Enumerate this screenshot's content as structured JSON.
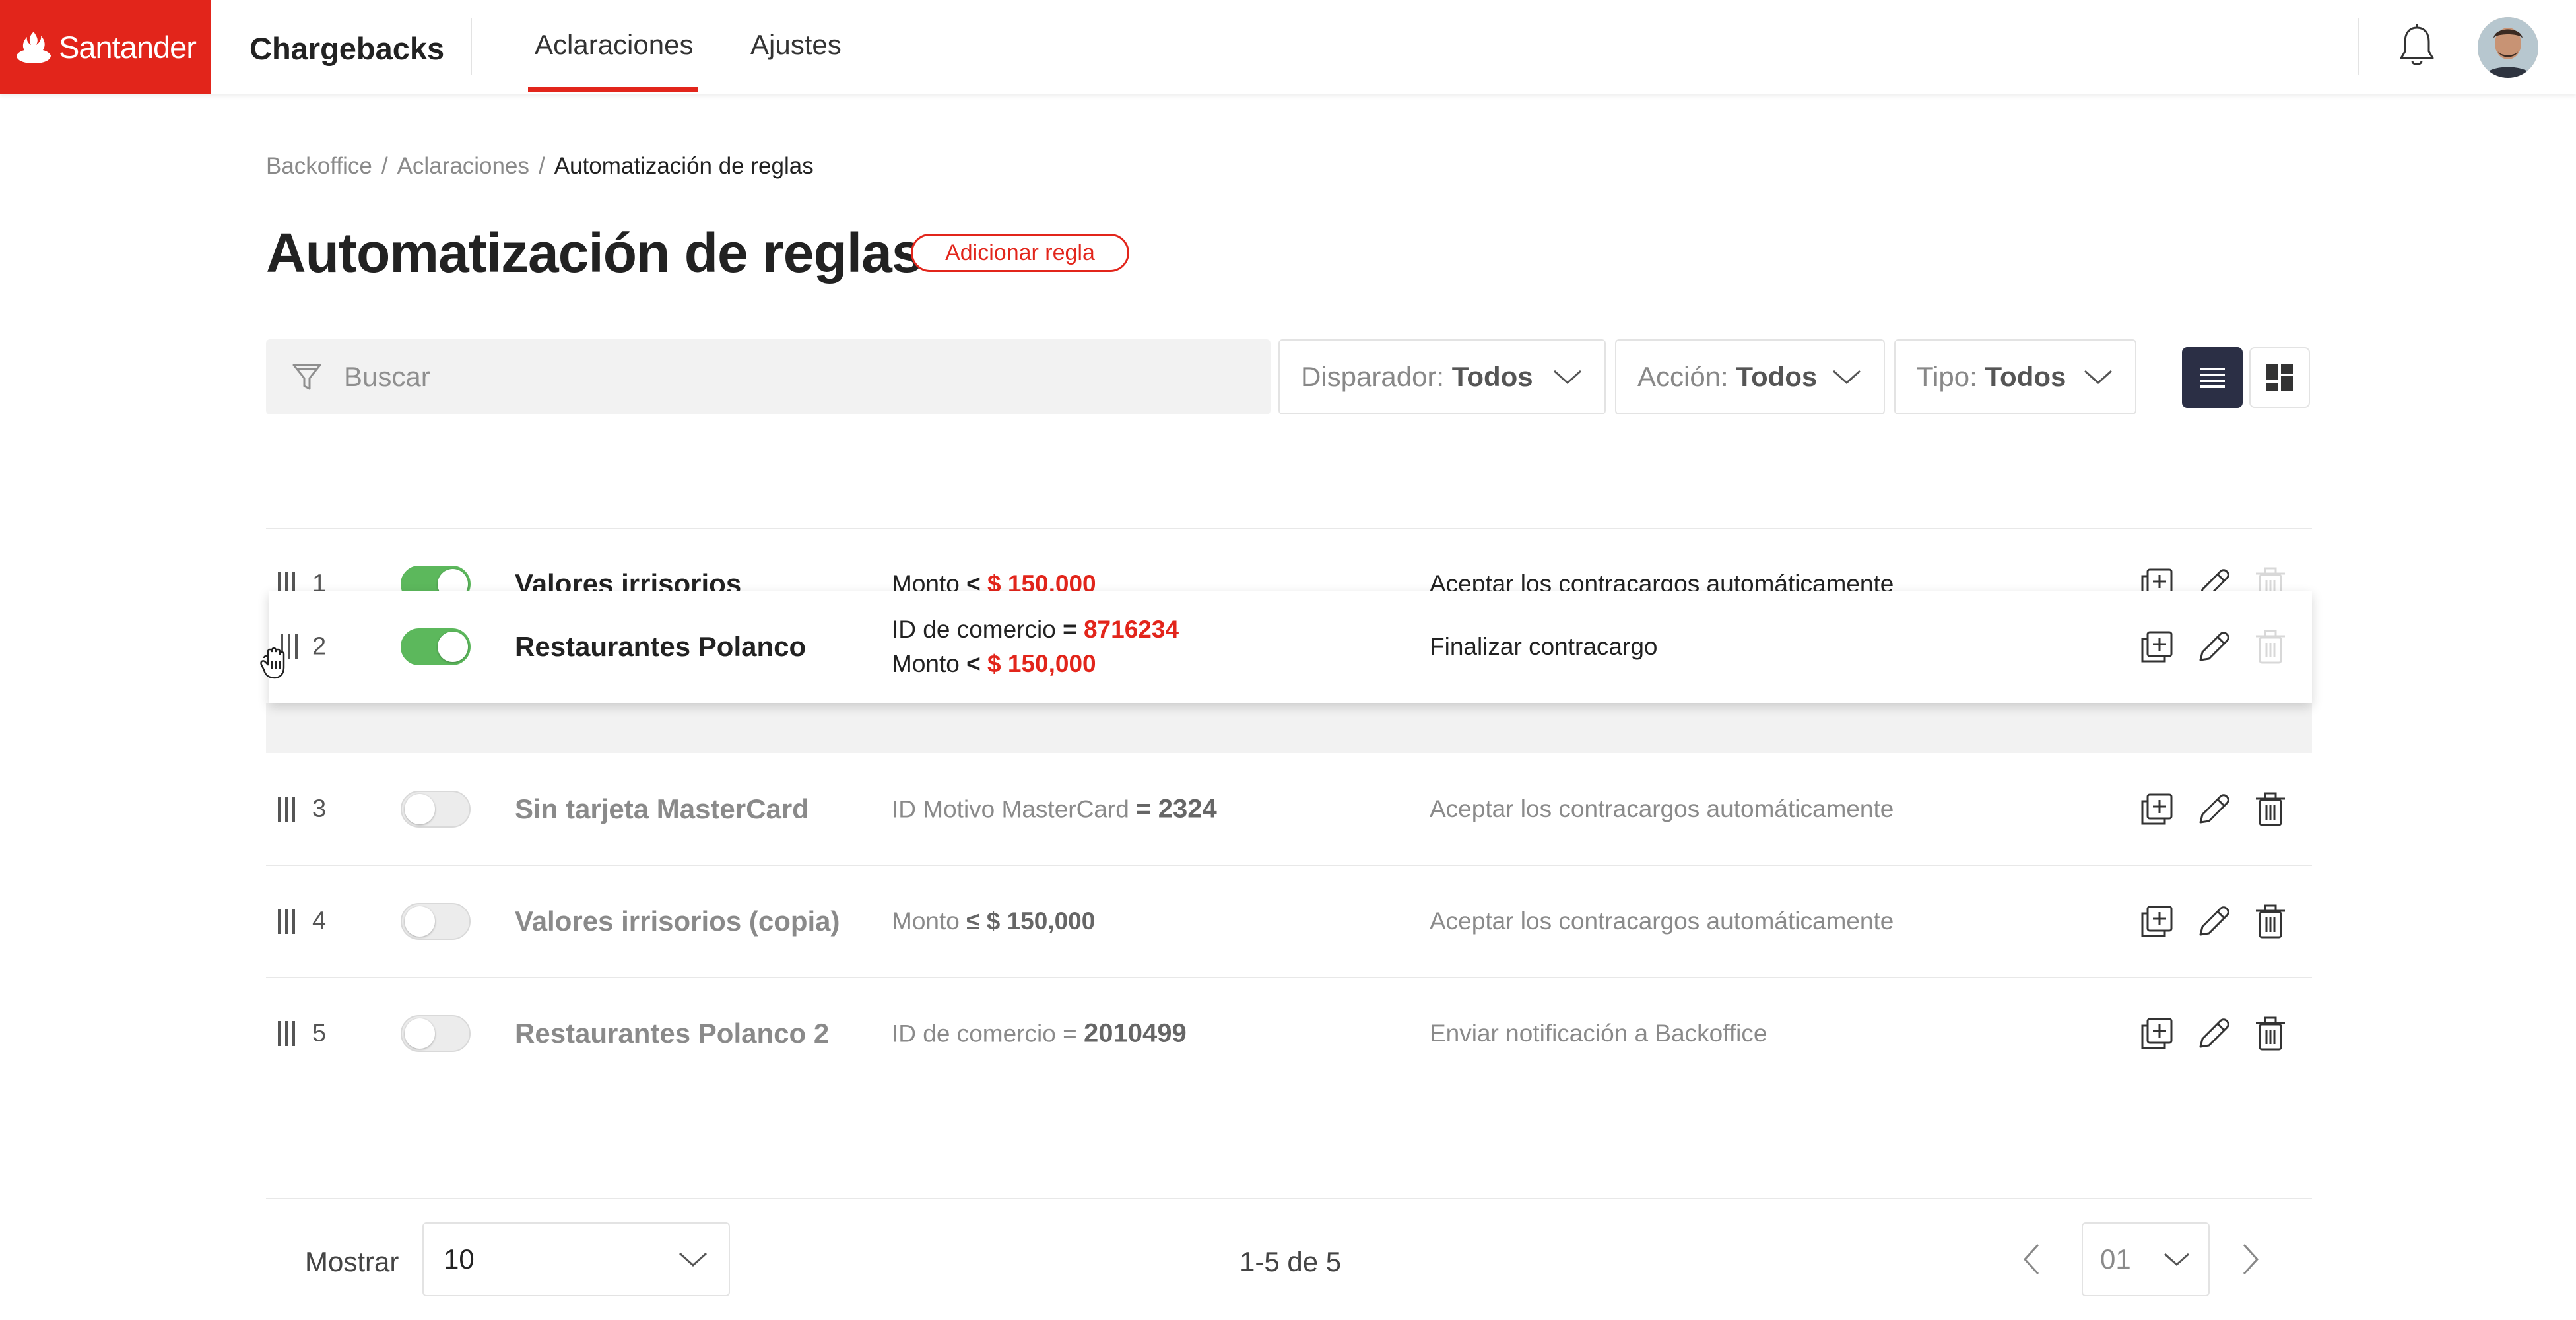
{
  "brand": {
    "name": "Santander",
    "color": "#e2251b"
  },
  "app": {
    "title": "Chargebacks"
  },
  "nav": {
    "tabs": [
      {
        "label": "Aclaraciones",
        "active": true
      },
      {
        "label": "Ajustes",
        "active": false
      }
    ]
  },
  "header": {
    "bell_icon": "bell-icon",
    "avatar_icon": "user-avatar"
  },
  "breadcrumb": {
    "items": [
      "Backoffice",
      "Aclaraciones",
      "Automatización de reglas"
    ],
    "separator": "/"
  },
  "page": {
    "title": "Automatización de reglas",
    "add_button": "Adicionar regla"
  },
  "filters": {
    "search_placeholder": "Buscar",
    "trigger": {
      "label": "Disparador:",
      "value": "Todos"
    },
    "action": {
      "label": "Acción:",
      "value": "Todos"
    },
    "type": {
      "label": "Tipo:",
      "value": "Todos"
    },
    "view_modes": [
      "list-view-icon",
      "grid-view-icon"
    ],
    "active_view": "list"
  },
  "rules": [
    {
      "num": "1",
      "enabled": true,
      "name": "Valores irrisorios",
      "cond_lines": [
        {
          "label": "Monto",
          "op": "<",
          "value": "$ 150,000"
        }
      ],
      "action": "Aceptar los contracargos automáticamente",
      "delete_disabled": true
    },
    {
      "num": "2",
      "enabled": true,
      "name": "Restaurantes Polanco",
      "cond_lines": [
        {
          "label": "ID de comercio",
          "op": "=",
          "value": "8716234"
        },
        {
          "label": "Monto",
          "op": "<",
          "value": "$ 150,000"
        }
      ],
      "action": "Finalizar contracargo",
      "delete_disabled": true,
      "dragging": true
    },
    {
      "num": "3",
      "enabled": false,
      "name": "Sin tarjeta MasterCard",
      "cond_lines": [
        {
          "label": "ID Motivo MasterCard",
          "op": "=",
          "value": "2324"
        }
      ],
      "action": "Aceptar los contracargos automáticamente",
      "delete_disabled": false
    },
    {
      "num": "4",
      "enabled": false,
      "name": "Valores irrisorios (copia)",
      "cond_lines": [
        {
          "label": "Monto",
          "op": "≤",
          "value": "$ 150,000"
        }
      ],
      "action": "Aceptar los contracargos automáticamente",
      "delete_disabled": false
    },
    {
      "num": "5",
      "enabled": false,
      "name": "Restaurantes Polanco 2",
      "cond_lines": [
        {
          "label": "ID de comercio",
          "op": "=",
          "value": "2010499"
        }
      ],
      "action": "Enviar notificación a Backoffice",
      "delete_disabled": false
    }
  ],
  "pagination": {
    "show_label": "Mostrar",
    "page_size": "10",
    "range": "1-5 de 5",
    "current_page": "01"
  }
}
